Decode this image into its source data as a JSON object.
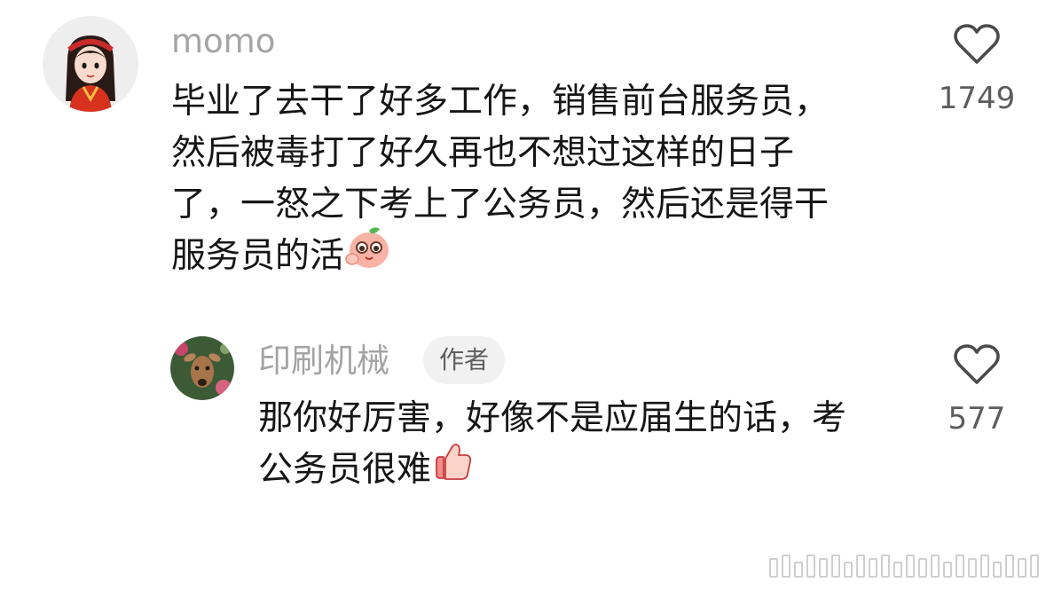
{
  "comments": [
    {
      "user": "momo",
      "text_lines": [
        "毕业了去干了好多工作，销售前台服务员，",
        "然后被毒打了好久再也不想过这样的日子",
        "了，一怒之下考上了公务员，然后还是得干",
        "服务员的活"
      ],
      "emoji": "face-palm-cheek-emoji",
      "likes": "1749"
    }
  ],
  "reply": {
    "user": "印刷机械",
    "badge": "作者",
    "text_lines": [
      "那你好厉害，好像不是应届生的话，考",
      "公务员很难"
    ],
    "emoji": "thumbs-up-emoji",
    "likes": "577"
  },
  "colors": {
    "username": "#a4a4a4",
    "text": "#161616",
    "like_count": "#5c5c5c",
    "badge_bg": "#f1f1f1"
  }
}
